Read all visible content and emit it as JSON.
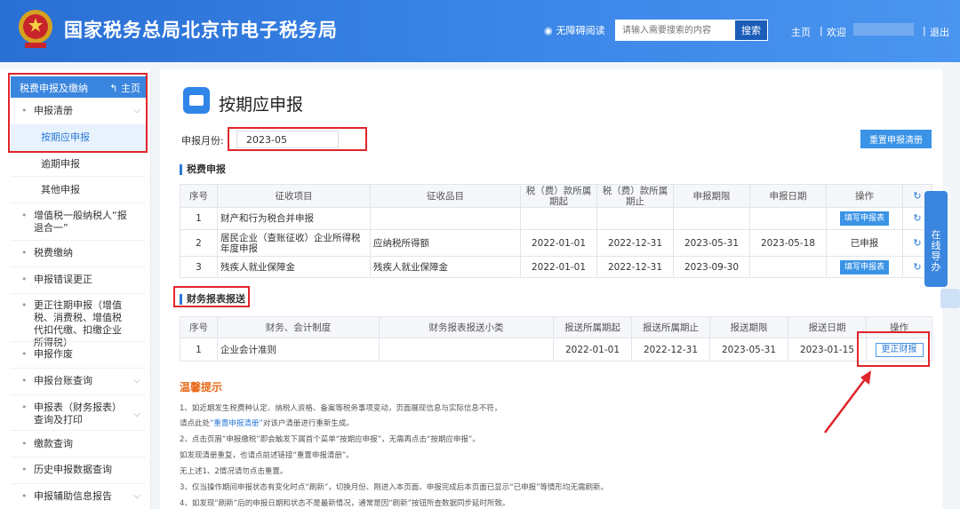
{
  "header": {
    "title": "国家税务总局北京市电子税务局",
    "access": "无障碍阅读",
    "search_placeholder": "请输入需要搜索的内容",
    "search_button": "搜索",
    "home": "主页",
    "sep": "|",
    "welcome": "欢迎",
    "logout": "退出"
  },
  "sidebar": {
    "head": "税费申报及缴纳",
    "home_link": "主页",
    "group_title": "申报清册",
    "subitems": [
      "按期应申报",
      "逾期申报",
      "其他申报"
    ],
    "items": [
      "增值税一般纳税人“报退合一”",
      "税费缴纳",
      "申报错误更正",
      "更正往期申报（增值税、消费税、增值税代扣代缴、扣缴企业所得税）",
      "申报作废",
      "申报台账查询",
      "申报表（财务报表）查询及打印",
      "缴款查询",
      "历史申报数据查询",
      "申报辅助信息报告"
    ]
  },
  "page": {
    "title": "按期应申报",
    "month_label": "申报月份:",
    "month_value": "2023-05",
    "reset_button": "重置申报清册"
  },
  "tax_section": {
    "title": "税费申报",
    "headers": [
      "序号",
      "征收项目",
      "征收品目",
      "税（费）款所属期起",
      "税（费）款所属期止",
      "申报期限",
      "申报日期",
      "操作"
    ],
    "rows": [
      {
        "no": "1",
        "item": "财产和行为税合并申报",
        "sub": "",
        "start": "",
        "end": "",
        "deadline": "",
        "date": "",
        "action": "填写申报表"
      },
      {
        "no": "2",
        "item": "居民企业（查账征收）企业所得税年度申报",
        "sub": "应纳税所得额",
        "start": "2022-01-01",
        "end": "2022-12-31",
        "deadline": "2023-05-31",
        "date": "2023-05-18",
        "action": "已申报"
      },
      {
        "no": "3",
        "item": "残疾人就业保障金",
        "sub": "残疾人就业保障金",
        "start": "2022-01-01",
        "end": "2022-12-31",
        "deadline": "2023-09-30",
        "date": "",
        "action": "填写申报表"
      }
    ]
  },
  "fin_section": {
    "title": "财务报表报送",
    "headers": [
      "序号",
      "财务、会计制度",
      "财务报表报送小类",
      "报送所属期起",
      "报送所属期止",
      "报送期限",
      "报送日期",
      "操作"
    ],
    "rows": [
      {
        "no": "1",
        "system": "企业会计准则",
        "sub": "",
        "start": "2022-01-01",
        "end": "2022-12-31",
        "deadline": "2023-05-31",
        "date": "2023-01-15",
        "action": "更正财报"
      }
    ]
  },
  "tips": {
    "title": "温馨提示",
    "line1": "1、如近期发生税费种认定、纳税人资格、备案等税务事项变动，页面展现信息与实际信息不符，",
    "line2a": "请点此处",
    "line2b": "“重置申报清册”",
    "line2c": "对该户清册进行重新生成。",
    "line3": "2、点击页眉“申报缴税”即会触发下属首个菜单“按期应申报”，无需再点击“按期应申报”。",
    "line4": "如发现清册重复，也请点前述链接“重置申报清册”。",
    "line5": "无上述1、2情况请勿点击重置。",
    "line6": "3、仅当操作期间申报状态有变化时点“刷新”，切换月份、刚进入本页面、申报完成后本页面已显示“已申报”等情形均无需刷新。",
    "line7": "4、如发现“刷新”后的申报日期和状态不是最新情况，通常是因“刷新”按钮所查数据同步延时所致。"
  },
  "float_panel": {
    "text": "在线导办"
  },
  "colors": {
    "header": "#2a6fd4",
    "accent": "#3a93e6",
    "highlight": "#e0252b",
    "tips": "#e86a1a"
  }
}
